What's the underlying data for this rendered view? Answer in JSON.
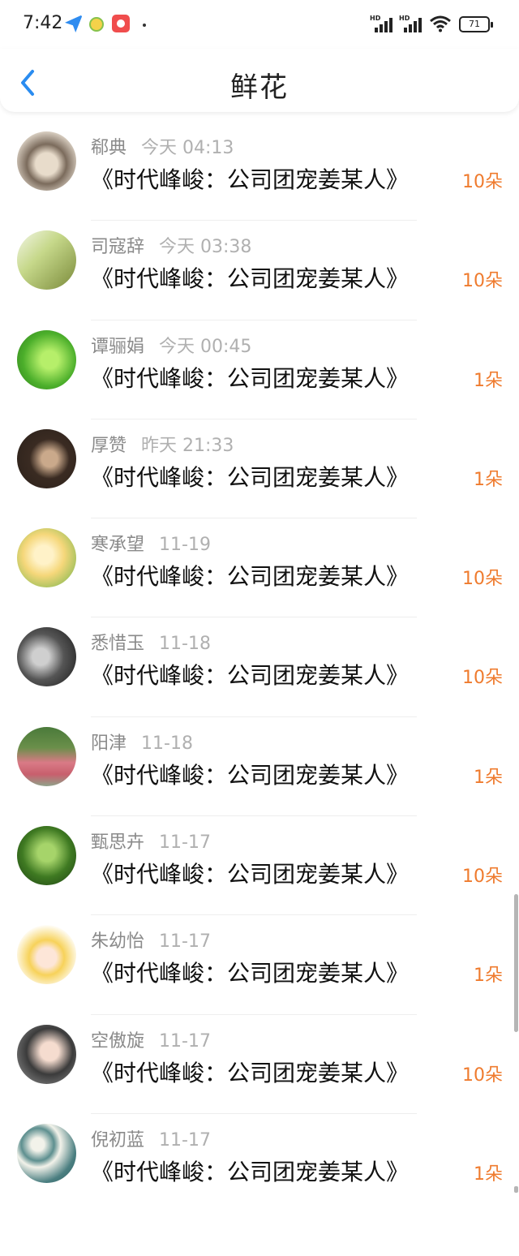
{
  "status_bar": {
    "time": "7:42",
    "battery": "71"
  },
  "header": {
    "title": "鲜花"
  },
  "items": [
    {
      "name": "郗典",
      "date": "今天 04:13",
      "book": "《时代峰峻：公司团宠姜某人》",
      "count": "10朵"
    },
    {
      "name": "司寇辞",
      "date": "今天 03:38",
      "book": "《时代峰峻：公司团宠姜某人》",
      "count": "10朵"
    },
    {
      "name": "谭骊娟",
      "date": "今天 00:45",
      "book": "《时代峰峻：公司团宠姜某人》",
      "count": "1朵"
    },
    {
      "name": "厚赞",
      "date": "昨天 21:33",
      "book": "《时代峰峻：公司团宠姜某人》",
      "count": "1朵"
    },
    {
      "name": "寒承望",
      "date": "11-19",
      "book": "《时代峰峻：公司团宠姜某人》",
      "count": "10朵"
    },
    {
      "name": "悉惜玉",
      "date": "11-18",
      "book": "《时代峰峻：公司团宠姜某人》",
      "count": "10朵"
    },
    {
      "name": "阳津",
      "date": "11-18",
      "book": "《时代峰峻：公司团宠姜某人》",
      "count": "1朵"
    },
    {
      "name": "甄思卉",
      "date": "11-17",
      "book": "《时代峰峻：公司团宠姜某人》",
      "count": "10朵"
    },
    {
      "name": "朱幼怡",
      "date": "11-17",
      "book": "《时代峰峻：公司团宠姜某人》",
      "count": "1朵"
    },
    {
      "name": "空傲旋",
      "date": "11-17",
      "book": "《时代峰峻：公司团宠姜某人》",
      "count": "10朵"
    },
    {
      "name": "倪初蓝",
      "date": "11-17",
      "book": "《时代峰峻：公司团宠姜某人》",
      "count": "1朵"
    }
  ],
  "colors": {
    "accent_count": "#ef7b2e",
    "back_arrow": "#2a8cf0"
  }
}
